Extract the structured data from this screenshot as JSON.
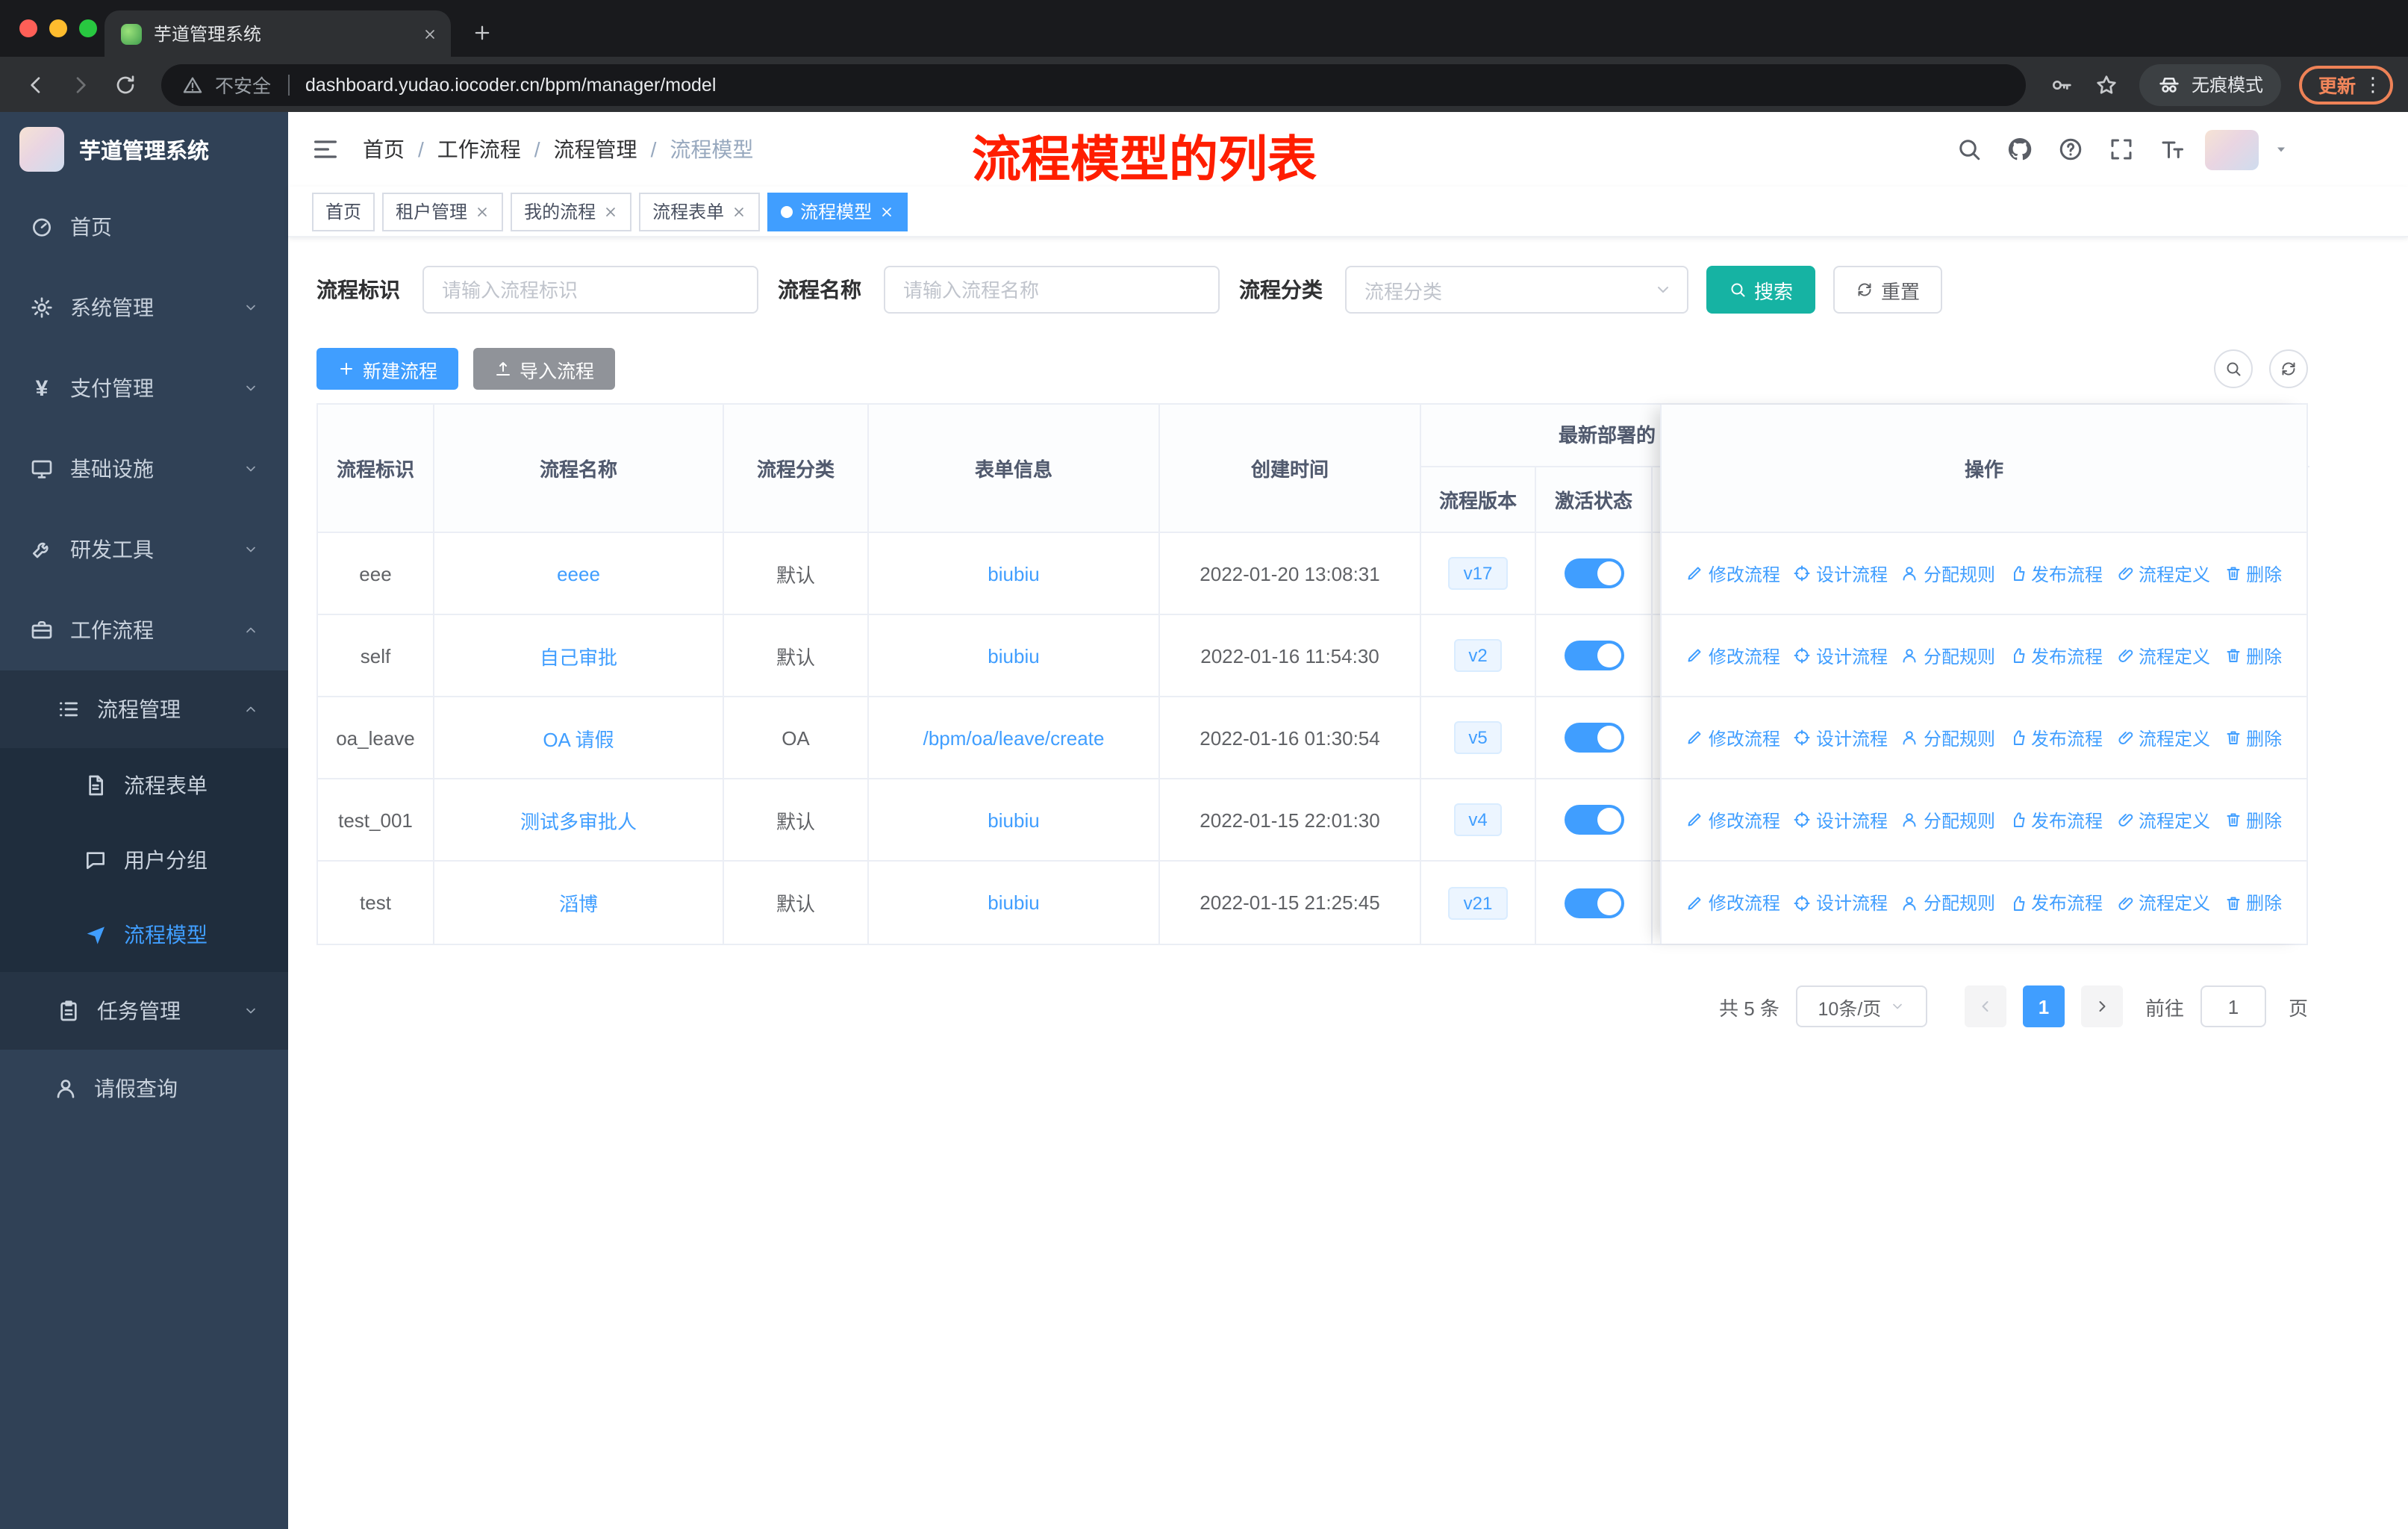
{
  "colors": {
    "accent": "#409eff",
    "search_button": "#16b3a3",
    "annotation_red": "#ff1e00",
    "sidebar_bg": "#304156",
    "import_button": "#909399"
  },
  "browser": {
    "tab_title": "芋道管理系统",
    "security_label": "不安全",
    "url": "dashboard.yudao.iocoder.cn/bpm/manager/model",
    "incognito_label": "无痕模式",
    "update_label": "更新"
  },
  "sidebar": {
    "logo_title": "芋道管理系统",
    "home": "首页",
    "system": "系统管理",
    "payment": "支付管理",
    "infrastructure": "基础设施",
    "devtools": "研发工具",
    "workflow": "工作流程",
    "process_mgmt": "流程管理",
    "process_form": "流程表单",
    "user_group": "用户分组",
    "process_model": "流程模型",
    "task_mgmt": "任务管理",
    "leave_query": "请假查询"
  },
  "header": {
    "breadcrumb": [
      "首页",
      "工作流程",
      "流程管理",
      "流程模型"
    ],
    "separator": "/",
    "annotation": "流程模型的列表"
  },
  "tags": [
    {
      "label": "首页",
      "closable": false,
      "active": false
    },
    {
      "label": "租户管理",
      "closable": true,
      "active": false
    },
    {
      "label": "我的流程",
      "closable": true,
      "active": false
    },
    {
      "label": "流程表单",
      "closable": true,
      "active": false
    },
    {
      "label": "流程模型",
      "closable": true,
      "active": true
    }
  ],
  "filters": {
    "key_label": "流程标识",
    "key_placeholder": "请输入流程标识",
    "name_label": "流程名称",
    "name_placeholder": "请输入流程名称",
    "category_label": "流程分类",
    "category_placeholder": "流程分类",
    "search_label": "搜索",
    "reset_label": "重置"
  },
  "toolbar": {
    "create_label": "新建流程",
    "import_label": "导入流程"
  },
  "table": {
    "columns": {
      "key": "流程标识",
      "name": "流程名称",
      "category": "流程分类",
      "form": "表单信息",
      "created": "创建时间",
      "deploy_group": "最新部署的",
      "version": "流程版本",
      "active": "激活状态",
      "actions": "操作"
    },
    "actions": [
      "修改流程",
      "设计流程",
      "分配规则",
      "发布流程",
      "流程定义",
      "删除"
    ],
    "action_icons": [
      "edit-icon",
      "design-icon",
      "assign-icon",
      "publish-icon",
      "definition-icon",
      "delete-icon"
    ],
    "rows": [
      {
        "key": "eee",
        "name": "eeee",
        "category": "默认",
        "form": "biubiu",
        "created": "2022-01-20 13:08:31",
        "version": "v17",
        "active": true
      },
      {
        "key": "self",
        "name": "自己审批",
        "category": "默认",
        "form": "biubiu",
        "created": "2022-01-16 11:54:30",
        "version": "v2",
        "active": true
      },
      {
        "key": "oa_leave",
        "name": "OA 请假",
        "category": "OA",
        "form": "/bpm/oa/leave/create",
        "created": "2022-01-16 01:30:54",
        "version": "v5",
        "active": true
      },
      {
        "key": "test_001",
        "name": "测试多审批人",
        "category": "默认",
        "form": "biubiu",
        "created": "2022-01-15 22:01:30",
        "version": "v4",
        "active": true
      },
      {
        "key": "test",
        "name": "滔博",
        "category": "默认",
        "form": "biubiu",
        "created": "2022-01-15 21:25:45",
        "version": "v21",
        "active": true
      }
    ]
  },
  "pagination": {
    "total": "共 5 条",
    "page_size": "10条/页",
    "current_page": "1",
    "goto_label": "前往",
    "goto_value": "1",
    "page_unit": "页"
  }
}
